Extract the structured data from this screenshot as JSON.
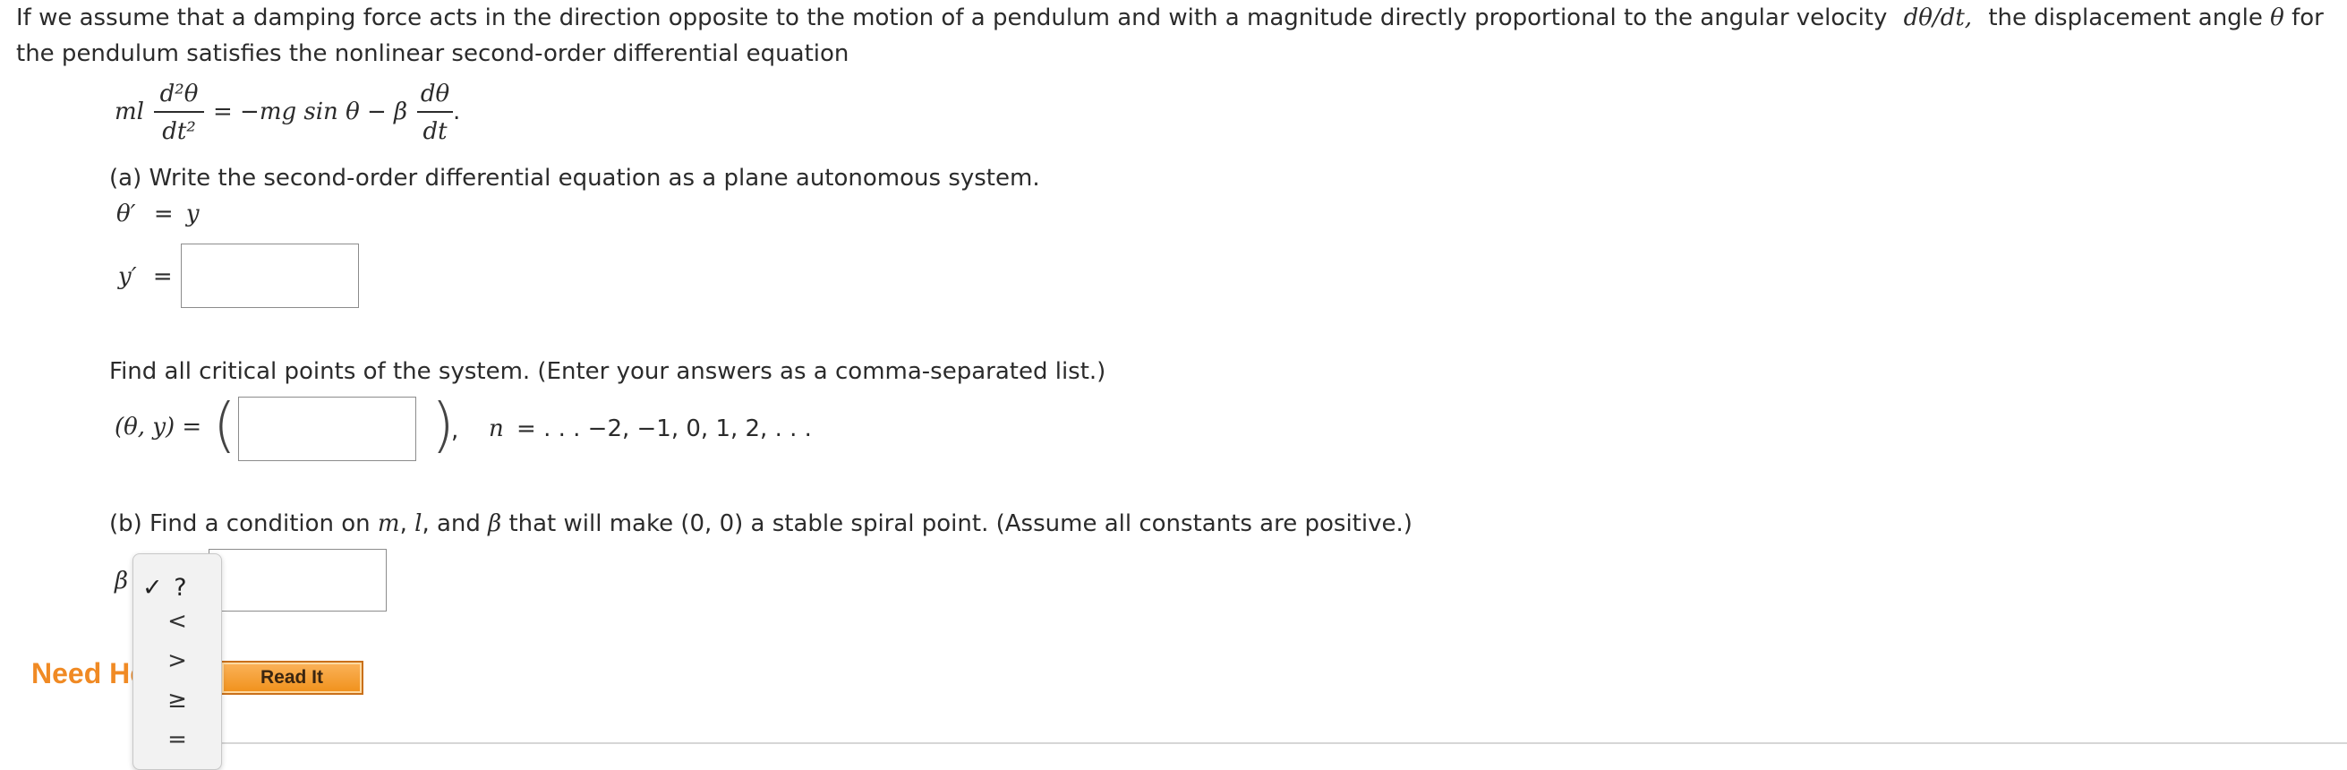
{
  "intro": {
    "line1_a": "If we assume that a damping force acts in the direction opposite to the motion of a pendulum and with a magnitude directly proportional to the angular velocity",
    "line1_expr": "dθ/dt,",
    "line1_b": "the displacement angle",
    "line1_theta": "θ",
    "line1_c": "for",
    "line2": "the pendulum satisfies the nonlinear second-order differential equation"
  },
  "equation": {
    "lhs_coef": "ml",
    "lhs_num": "d²θ",
    "lhs_den": "dt²",
    "rhs": "= −mg sin θ − β",
    "rhs_num": "dθ",
    "rhs_den": "dt",
    "end": "."
  },
  "part_a": {
    "prompt": "(a) Write the second-order differential equation as a plane autonomous system.",
    "theta_prime_lhs": "θ′",
    "theta_prime_eq": "=",
    "theta_prime_rhs": "y",
    "y_prime_lhs": "y′",
    "y_prime_eq": "=",
    "y_prime_value": ""
  },
  "critical": {
    "prompt": "Find all critical points of the system. (Enter your answers as a comma-separated list.)",
    "lhs": "(θ, y) =",
    "value": "",
    "comma": ",",
    "n_label": "n",
    "n_range": "= . . . −2, −1, 0, 1, 2, . . ."
  },
  "part_b": {
    "prompt_a": "(b) Find a condition on",
    "m": "m",
    "sep1": ",",
    "l": "l",
    "sep2": ", and",
    "beta": "β",
    "prompt_b": "that will make (0, 0) a stable spiral point. (Assume all constants are positive.)",
    "lhs": "β",
    "value": ""
  },
  "relation_dropdown": {
    "selected_check": "✓",
    "selected": "?",
    "options": [
      "<",
      ">",
      "≥",
      "="
    ]
  },
  "help": {
    "label": "Need Help?",
    "read_it": "Read It"
  }
}
